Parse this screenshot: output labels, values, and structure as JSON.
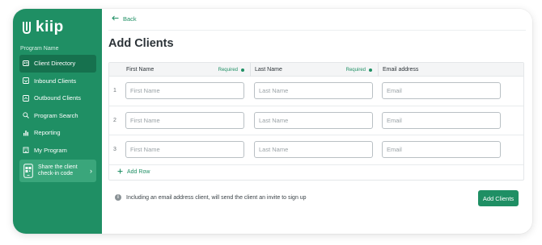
{
  "app": {
    "logo_text": "kiip"
  },
  "sidebar": {
    "section_label": "Program Name",
    "items": [
      {
        "label": "Client Directory",
        "icon": "id-card-icon",
        "active": true
      },
      {
        "label": "Inbound Clients",
        "icon": "inbox-icon",
        "active": false
      },
      {
        "label": "Outbound Clients",
        "icon": "outbox-icon",
        "active": false
      },
      {
        "label": "Program Search",
        "icon": "search-icon",
        "active": false
      },
      {
        "label": "Reporting",
        "icon": "bar-chart-icon",
        "active": false
      },
      {
        "label": "My Program",
        "icon": "building-icon",
        "active": false
      }
    ],
    "share": {
      "label": "Share the client check-in code",
      "icon": "qr-phone-icon"
    }
  },
  "main": {
    "back_label": "Back",
    "title": "Add Clients",
    "table": {
      "headers": [
        {
          "label": "First Name",
          "required_label": "Required"
        },
        {
          "label": "Last Name",
          "required_label": "Required"
        },
        {
          "label": "Email address",
          "required_label": ""
        }
      ],
      "rows": [
        {
          "number": "1",
          "first_placeholder": "First Name",
          "last_placeholder": "Last Name",
          "email_placeholder": "Email"
        },
        {
          "number": "2",
          "first_placeholder": "First Name",
          "last_placeholder": "Last Name",
          "email_placeholder": "Email"
        },
        {
          "number": "3",
          "first_placeholder": "First Name",
          "last_placeholder": "Last Name",
          "email_placeholder": "Email"
        }
      ],
      "add_row_label": "Add Row"
    },
    "info_text": "Including an email address client, will send the client an invite to sign up",
    "submit_label": "Add Clients"
  },
  "colors": {
    "brand": "#1f8f64",
    "brand_dark": "#16714e",
    "share_card": "#3aa67b"
  }
}
